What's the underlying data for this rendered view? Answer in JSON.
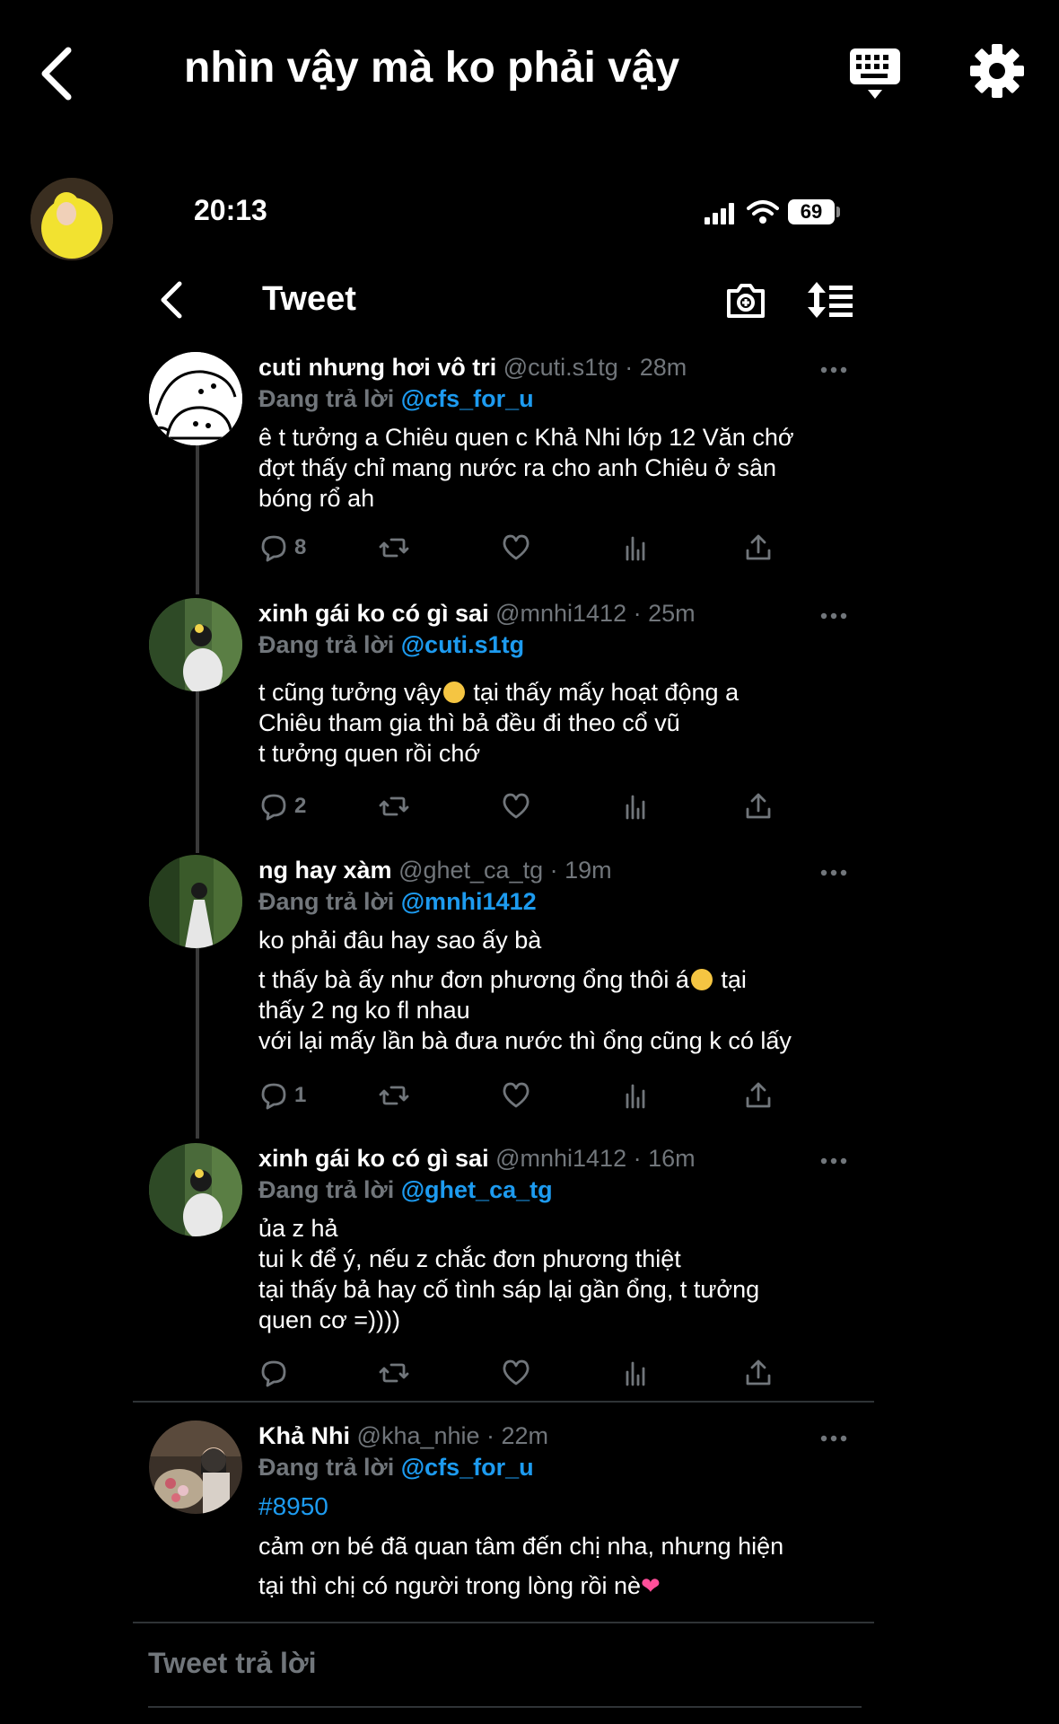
{
  "app": {
    "title": "nhìn vậy mà ko phải vậy"
  },
  "phone": {
    "time": "20:13",
    "battery": "69"
  },
  "tweet_screen": {
    "header_title": "Tweet"
  },
  "reply_prefix": "Đang trả lời",
  "tweets": [
    {
      "name": "cuti nhưng hơi vô tri",
      "meta": "@cuti.s1tg · 28m",
      "reply_to": "@cfs_for_u",
      "text": "ê t tưởng a Chiêu quen c Khả Nhi lớp 12 Văn chớ\nđợt thấy chỉ mang nước ra cho anh Chiêu ở sân\nbóng rổ ah",
      "reply_count": "8"
    },
    {
      "name": "xinh gái ko có gì sai",
      "meta": "@mnhi1412 · 25m",
      "reply_to": "@cuti.s1tg",
      "text_a": "t cũng tưởng vậy",
      "text_b": " tại thấy mấy hoạt động a\nChiêu tham gia thì bả đều đi theo cổ vũ\nt tưởng quen rồi chớ",
      "reply_count": "2"
    },
    {
      "name": "ng hay xàm",
      "meta": "@ghet_ca_tg · 19m",
      "reply_to": "@mnhi1412",
      "text_1": "ko phải đâu hay sao ấy bà",
      "text_2a": "t thấy bà ấy như đơn phương ổng thôi á",
      "text_2b": " tại\nthấy 2 ng ko fl nhau\nvới lại mấy lần bà đưa nước thì ổng cũng k có lấy",
      "reply_count": "1"
    },
    {
      "name": "xinh gái ko có gì sai",
      "meta": "@mnhi1412 · 16m",
      "reply_to": "@ghet_ca_tg",
      "text": "ủa z hả\ntui k để ý, nếu z chắc đơn phương thiệt\ntại thấy bả hay cố tình sáp lại gần ổng, t tưởng\nquen cơ =))))",
      "reply_count": ""
    },
    {
      "name": "Khả Nhi",
      "meta": "@kha_nhie · 22m",
      "reply_to": "@cfs_for_u",
      "hashtag": "#8950",
      "text": "cảm ơn bé đã quan tâm đến chị nha, nhưng hiện\ntại thì chị có người trong lòng rồi nè"
    }
  ],
  "compose": {
    "placeholder": "Tweet trả lời"
  },
  "colors": {
    "background": "#000000",
    "accent": "#1d9bf0",
    "muted": "#71767b"
  },
  "icons": [
    "back-icon",
    "keyboard-icon",
    "gear-icon",
    "camera-icon",
    "sort-icon",
    "more-icon",
    "reply-icon",
    "retweet-icon",
    "like-icon",
    "views-icon",
    "share-icon"
  ]
}
